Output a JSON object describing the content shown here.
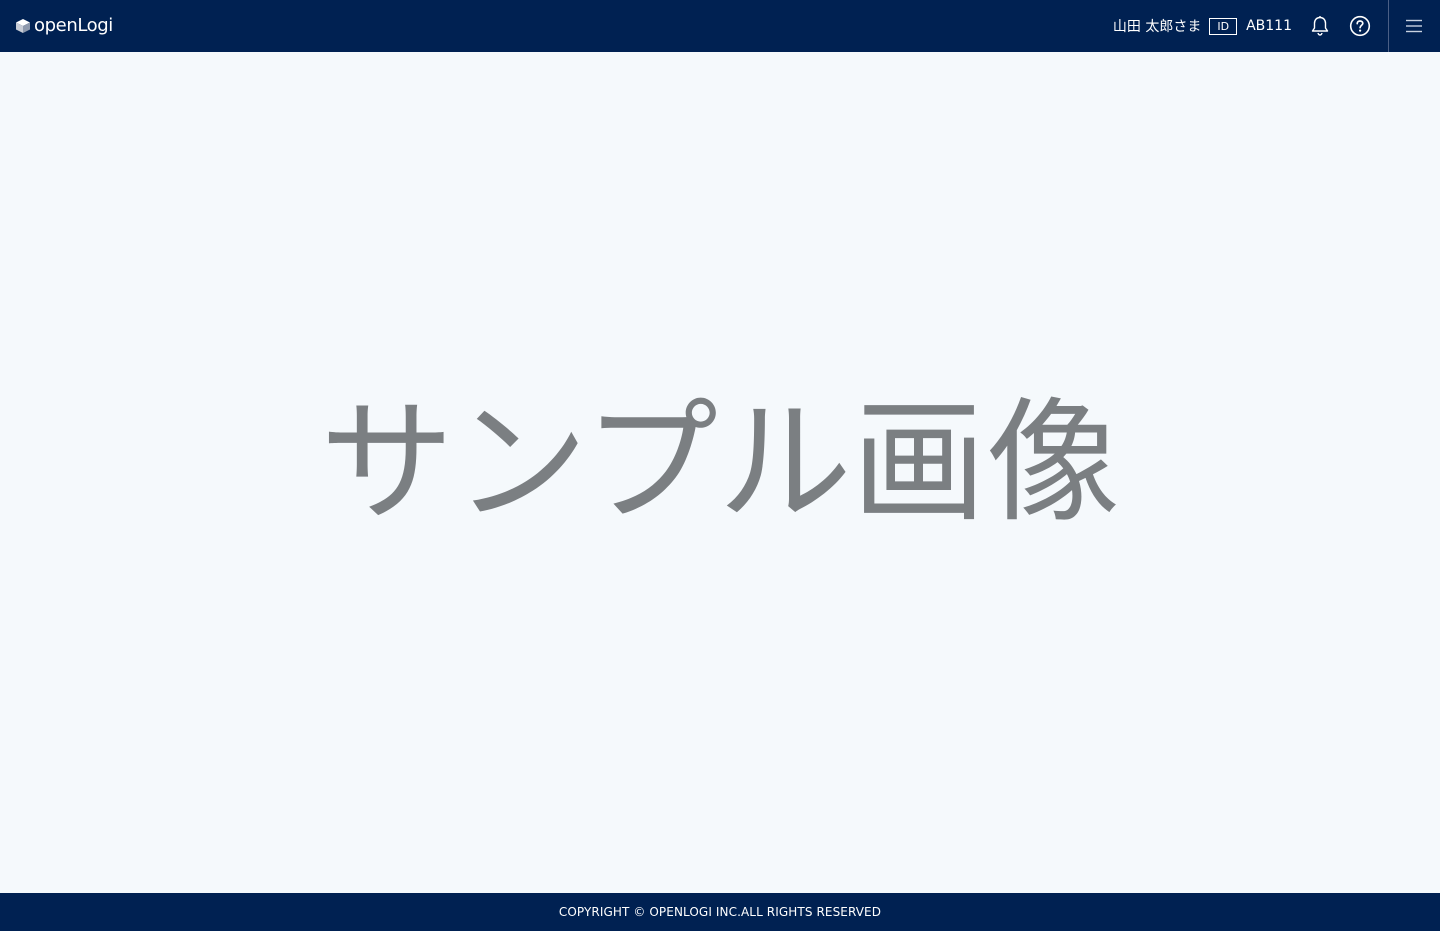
{
  "header": {
    "logo_text": "openLogi",
    "user_name": "山田 太郎さま",
    "id_badge": "ID",
    "user_code": "AB111",
    "icons": [
      "logo-cube-icon",
      "bell-icon",
      "help-icon",
      "hamburger-menu-icon"
    ]
  },
  "main": {
    "placeholder_text": "サンプル画像"
  },
  "footer": {
    "copyright": "COPYRIGHT © OPENLOGI INC.ALL RIGHTS RESERVED"
  },
  "colors": {
    "header_bg": "#002152",
    "page_bg": "#f5f9fc",
    "placeholder_text": "#7b7f82",
    "text_on_dark": "#ffffff"
  }
}
